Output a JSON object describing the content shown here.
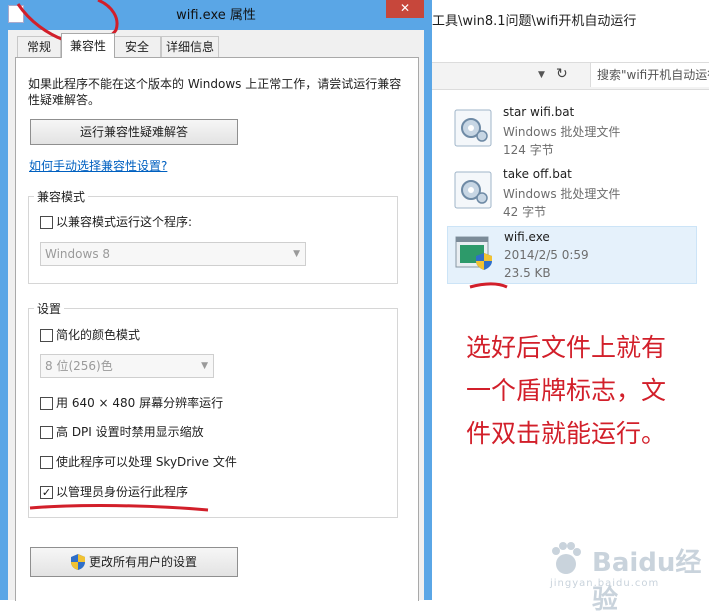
{
  "dialog": {
    "title": "wifi.exe 属性",
    "close_label": "✕",
    "tabs": [
      {
        "label": "常规"
      },
      {
        "label": "兼容性"
      },
      {
        "label": "安全"
      },
      {
        "label": "详细信息"
      }
    ],
    "description": "如果此程序不能在这个版本的 Windows 上正常工作，请尝试运行兼容性疑难解答。",
    "troubleshoot_button": "运行兼容性疑难解答",
    "manual_link": "如何手动选择兼容性设置?",
    "compat_mode": {
      "group_label": "兼容模式",
      "checkbox_label": "以兼容模式运行这个程序:",
      "checked": false,
      "os_select_value": "Windows 8"
    },
    "settings": {
      "group_label": "设置",
      "reduced_color_label": "简化的颜色模式",
      "color_select_value": "8 位(256)色",
      "options": [
        {
          "label": "用 640 × 480 屏幕分辨率运行",
          "checked": false
        },
        {
          "label": "高 DPI 设置时禁用显示缩放",
          "checked": false
        },
        {
          "label": "使此程序可以处理 SkyDrive 文件",
          "checked": false
        },
        {
          "label": "以管理员身份运行此程序",
          "checked": true
        }
      ]
    },
    "all_users_button": "更改所有用户的设置"
  },
  "explorer": {
    "path": "工具\\win8.1问题\\wifi开机自动运行",
    "search_placeholder": "搜索\"wifi开机自动运行\"",
    "files": [
      {
        "name": "star wifi.bat",
        "type": "Windows 批处理文件",
        "size": "124 字节",
        "icon": "batch-file-icon"
      },
      {
        "name": "take off.bat",
        "type": "Windows 批处理文件",
        "size": "42 字节",
        "icon": "batch-file-icon"
      },
      {
        "name": "wifi.exe",
        "type": "2014/2/5 0:59",
        "size": "23.5 KB",
        "icon": "exe-shield-icon"
      }
    ]
  },
  "annotation": {
    "lines": [
      "选好后文件上就有",
      "一个盾牌标志，文",
      "件双击就能运行。"
    ],
    "color": "#d21f2a"
  },
  "watermark": {
    "text": "Baidu经验",
    "sub": "jingyan.baidu.com"
  }
}
